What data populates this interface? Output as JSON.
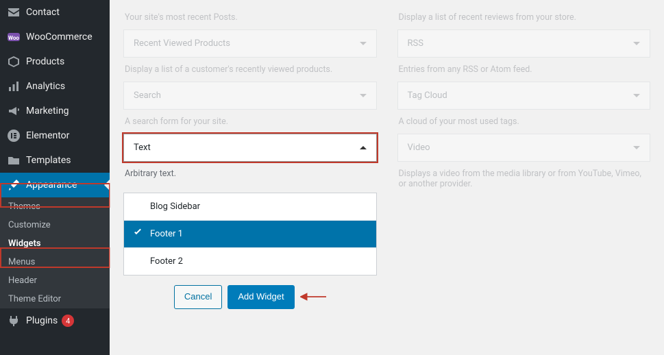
{
  "sidebar": {
    "top_items": [
      {
        "label": "Contact"
      },
      {
        "label": "WooCommerce"
      },
      {
        "label": "Products"
      },
      {
        "label": "Analytics"
      },
      {
        "label": "Marketing"
      },
      {
        "label": "Elementor"
      },
      {
        "label": "Templates"
      }
    ],
    "appearance_label": "Appearance",
    "appearance_sub": [
      {
        "label": "Themes"
      },
      {
        "label": "Customize"
      },
      {
        "label": "Widgets"
      },
      {
        "label": "Menus"
      },
      {
        "label": "Header"
      },
      {
        "label": "Theme Editor"
      }
    ],
    "plugins_label": "Plugins",
    "plugins_badge": "4"
  },
  "widgets": {
    "left": {
      "recent_posts_desc": "Your site's most recent Posts.",
      "rvp_title": "Recent Viewed Products",
      "rvp_desc": "Display a list of a customer's recently viewed products.",
      "search_title": "Search",
      "search_desc": "A search form for your site.",
      "text_title": "Text",
      "text_desc": "Arbitrary text."
    },
    "right": {
      "reviews_desc": "Display a list of recent reviews from your store.",
      "rss_title": "RSS",
      "rss_desc": "Entries from any RSS or Atom feed.",
      "tag_title": "Tag Cloud",
      "tag_desc": "A cloud of your most used tags.",
      "video_title": "Video",
      "video_desc": "Displays a video from the media library or from YouTube, Vimeo, or another provider."
    }
  },
  "areas": {
    "blog_sidebar": "Blog Sidebar",
    "footer1": "Footer 1",
    "footer2": "Footer 2"
  },
  "actions": {
    "cancel": "Cancel",
    "add": "Add Widget"
  }
}
